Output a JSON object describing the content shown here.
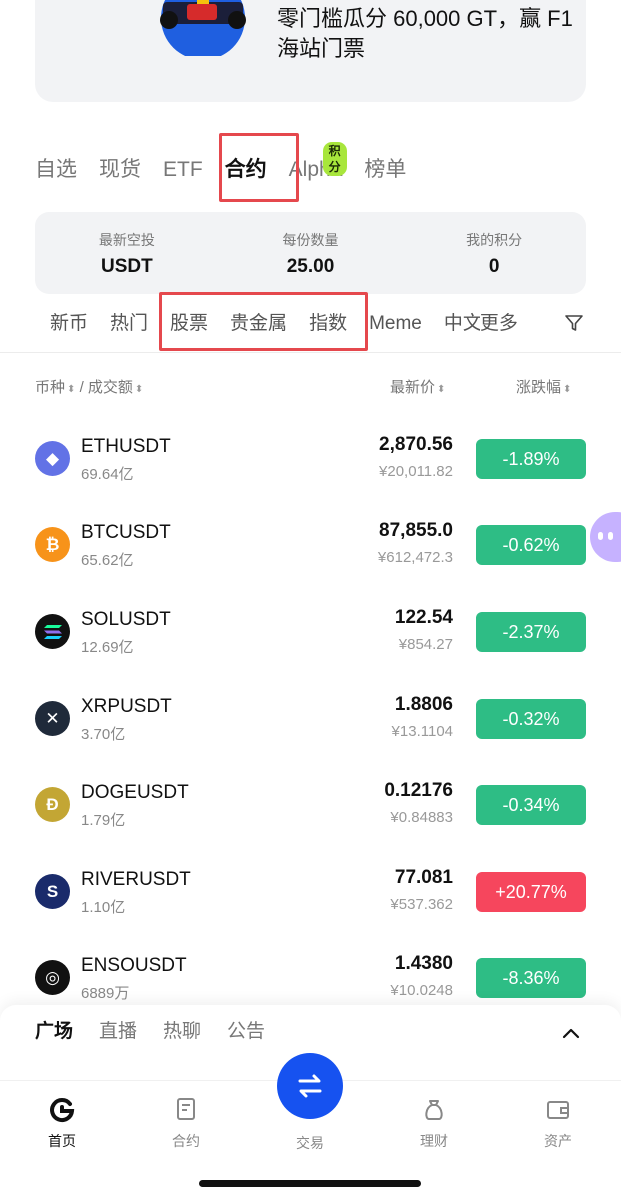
{
  "banner": {
    "text_line1": "零门槛瓜分 60,000 GT，赢 F1",
    "text_line2": "海站门票"
  },
  "main_tabs": [
    {
      "label": "自选"
    },
    {
      "label": "现货"
    },
    {
      "label": "ETF"
    },
    {
      "label": "合约",
      "active": true
    },
    {
      "label": "Alpha",
      "badge": "积分"
    },
    {
      "label": "榜单"
    }
  ],
  "airdrop": [
    {
      "label": "最新空投",
      "value": "USDT"
    },
    {
      "label": "每份数量",
      "value": "25.00"
    },
    {
      "label": "我的积分",
      "value": "0"
    }
  ],
  "sub_tabs": [
    "新币",
    "热门",
    "股票",
    "贵金属",
    "指数",
    "Meme",
    "中文",
    "更多"
  ],
  "header": {
    "coin_col": "币种",
    "volume_col": "/ 成交额",
    "price_col": "最新价",
    "change_col": "涨跌幅"
  },
  "rows": [
    {
      "symbol": "ETHUSDT",
      "volume": "69.64亿",
      "price": "2,870.56",
      "cny": "¥20,011.82",
      "change": "-1.89%",
      "direction": "down",
      "icon": "ethereum-icon",
      "color": "#6272e6",
      "glyph": "◆"
    },
    {
      "symbol": "BTCUSDT",
      "volume": "65.62亿",
      "price": "87,855.0",
      "cny": "¥612,472.3",
      "change": "-0.62%",
      "direction": "down",
      "icon": "bitcoin-icon",
      "color": "#f7931a",
      "glyph": "₿"
    },
    {
      "symbol": "SOLUSDT",
      "volume": "12.69亿",
      "price": "122.54",
      "cny": "¥854.27",
      "change": "-2.37%",
      "direction": "down",
      "icon": "solana-icon",
      "color": "#111111",
      "glyph": "≡"
    },
    {
      "symbol": "XRPUSDT",
      "volume": "3.70亿",
      "price": "1.8806",
      "cny": "¥13.1104",
      "change": "-0.32%",
      "direction": "down",
      "icon": "xrp-icon",
      "color": "#1f2a3a",
      "glyph": "✕"
    },
    {
      "symbol": "DOGEUSDT",
      "volume": "1.79亿",
      "price": "0.12176",
      "cny": "¥0.84883",
      "change": "-0.34%",
      "direction": "down",
      "icon": "dogecoin-icon",
      "color": "#c3a634",
      "glyph": "Ð"
    },
    {
      "symbol": "RIVERUSDT",
      "volume": "1.10亿",
      "price": "77.081",
      "cny": "¥537.362",
      "change": "+20.77%",
      "direction": "up",
      "icon": "river-icon",
      "color": "#1a2b6b",
      "glyph": "S"
    },
    {
      "symbol": "ENSOUSDT",
      "volume": "6889万",
      "price": "1.4380",
      "cny": "¥10.0248",
      "change": "-8.36%",
      "direction": "down",
      "icon": "enso-icon",
      "color": "#111111",
      "glyph": "◎"
    }
  ],
  "square_tabs": [
    {
      "label": "广场",
      "active": true
    },
    {
      "label": "直播"
    },
    {
      "label": "热聊"
    },
    {
      "label": "公告"
    }
  ],
  "nav": {
    "home": "首页",
    "futures": "合约",
    "trade": "交易",
    "finance": "理财",
    "assets": "资产"
  },
  "colors": {
    "up": "#f6465d",
    "down": "#2ebd85",
    "accent": "#1652f0",
    "highlight": "#e5484d"
  }
}
